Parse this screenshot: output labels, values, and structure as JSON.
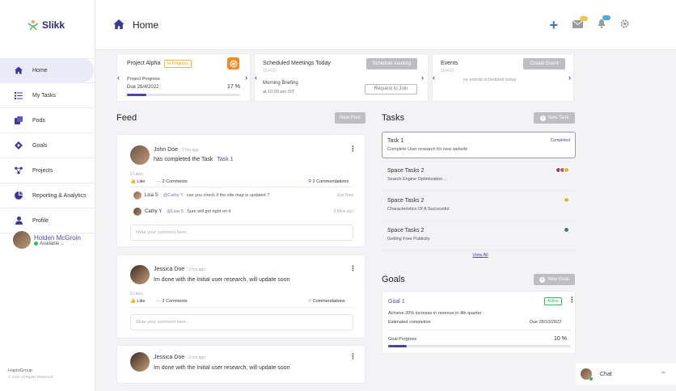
{
  "app": {
    "name": "Slikk"
  },
  "sidebar": {
    "items": [
      {
        "label": "Home"
      },
      {
        "label": "My Tasks"
      },
      {
        "label": "Pods"
      },
      {
        "label": "Goals"
      },
      {
        "label": "Projects"
      },
      {
        "label": "Reporting & Analytics"
      },
      {
        "label": "Profile"
      }
    ],
    "user": {
      "name": "Holden McGroin",
      "status": "Available"
    },
    "footer": {
      "company": "HaptoGroup",
      "copyright": "© 2022 All Rights Reserved"
    }
  },
  "header": {
    "title": "Home",
    "mail_badge": "12",
    "bell_badge": "67"
  },
  "project": {
    "name": "Project Alpha",
    "badge": "In Progress",
    "progress_label": "Project Progress",
    "due": "Due 26/4/2022",
    "progress_value": "17 %",
    "progress_fraction": 0.17
  },
  "meetings": {
    "title": "Scheduled Meetings Today",
    "schedule_btn": "Schedule meeting",
    "date": "15/4/22",
    "meeting_name": "Morning Briefing",
    "meeting_time": "at 10:00 am IST",
    "join_btn": "Request to Join"
  },
  "events": {
    "title": "Events",
    "create_btn": "Create Event",
    "date": "15/4/22",
    "empty": "no events scheduled today"
  },
  "feed": {
    "title": "Feed",
    "new_post": "New Post",
    "posts": [
      {
        "author": "John Doe",
        "time": "2 hrs ago",
        "text": "has completed the Task",
        "link": "Task 1",
        "likes": "5 Likes",
        "like_label": "Like",
        "comments_label": "2 Comments",
        "commendations_label": "2 Commendations",
        "replies": [
          {
            "author": "Lisa S",
            "mention": "@Cathy Y",
            "text": "can you check if the site map is updated ?",
            "time": "Just Now"
          },
          {
            "author": "Cathy Y",
            "mention": "@Lisa S",
            "text": "Sure will get right on it",
            "time": "2 Mins ago"
          }
        ],
        "placeholder": "Write your comment here..."
      },
      {
        "author": "Jessica Doe",
        "time": "2 hrs ago",
        "text": "Im done with the Initial user research, will update soon",
        "likes": "5 Likes",
        "like_label": "Like",
        "comments_label": "2 Comments",
        "commendations_label": "Commendations",
        "placeholder": "Write your comment here..."
      },
      {
        "author": "Jessica Doe",
        "time": "2 hrs ago",
        "text": "Im done with the Initial user research, will update soon"
      }
    ]
  },
  "tasks": {
    "title": "Tasks",
    "new_btn": "New Task",
    "view_all": "View All",
    "items": [
      {
        "title": "Task 1",
        "sub": "Complete User research for new website",
        "status": "Completed"
      },
      {
        "title": "Space Tasks 2",
        "sub": "Search Engine Optimization ..."
      },
      {
        "title": "Space Tasks 2",
        "sub": "Characteristics Of A Successful"
      },
      {
        "title": "Space Tasks 2",
        "sub": "Getting Free Publicity"
      }
    ]
  },
  "goals": {
    "title": "Goals",
    "new_btn": "New Goal",
    "item": {
      "name": "Goal 1",
      "status": "Active",
      "desc": "Achieve 20% increase in revenue in 4th quarter",
      "estimate_label": "Estimated completion",
      "due": "Due 28/10/2022",
      "progress_label": "Goal Progress",
      "progress_value": "10 %",
      "progress_fraction": 0.1
    }
  },
  "chat": {
    "label": "Chat"
  }
}
